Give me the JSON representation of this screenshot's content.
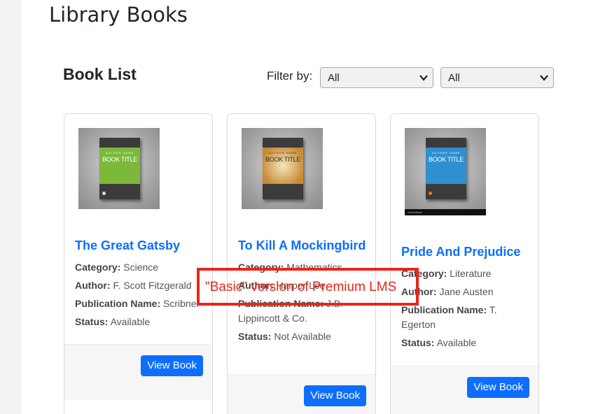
{
  "page": {
    "title": "Library Books"
  },
  "section": {
    "title": "Book List"
  },
  "filters": {
    "label": "Filter by:",
    "category_select": {
      "value": "All"
    },
    "status_select": {
      "value": "All"
    }
  },
  "books": [
    {
      "cover": {
        "author_text": "AUTHOR NAME",
        "title_text": "BOOK TITLE",
        "color": "#7cb83a"
      },
      "title": "The Great Gatsby",
      "category_label": "Category:",
      "category": "Science",
      "author_label": "Author:",
      "author": "F. Scott Fitzgerald",
      "publication_label": "Publication Name:",
      "publication": "Scribner",
      "status_label": "Status:",
      "status": "Available",
      "button": "View Book"
    },
    {
      "cover": {
        "author_text": "AUTHOR NAME",
        "title_text": "BOOK TITLE",
        "color": "#c98a35"
      },
      "title": "To Kill A Mockingbird",
      "category_label": "Category:",
      "category": "Mathematics",
      "author_label": "Author:",
      "author": "Harper Lee",
      "publication_label": "Publication Name:",
      "publication": "J.B. Lippincott & Co.",
      "status_label": "Status:",
      "status": "Not Available",
      "button": "View Book"
    },
    {
      "cover": {
        "author_text": "AUTHOR NAME",
        "title_text": "BOOK TITLE",
        "color": "#2f8fd0",
        "footer": "vectorStock"
      },
      "title": "Pride And Prejudice",
      "category_label": "Category:",
      "category": "Literature",
      "author_label": "Author:",
      "author": "Jane Austen",
      "publication_label": "Publication Name:",
      "publication": "T. Egerton",
      "status_label": "Status:",
      "status": "Available",
      "button": "View Book"
    }
  ],
  "watermark": {
    "text": "\"Basic\" version of Premium LMS"
  },
  "colors": {
    "accent": "#0d6efd",
    "watermark": "#e8261a"
  }
}
